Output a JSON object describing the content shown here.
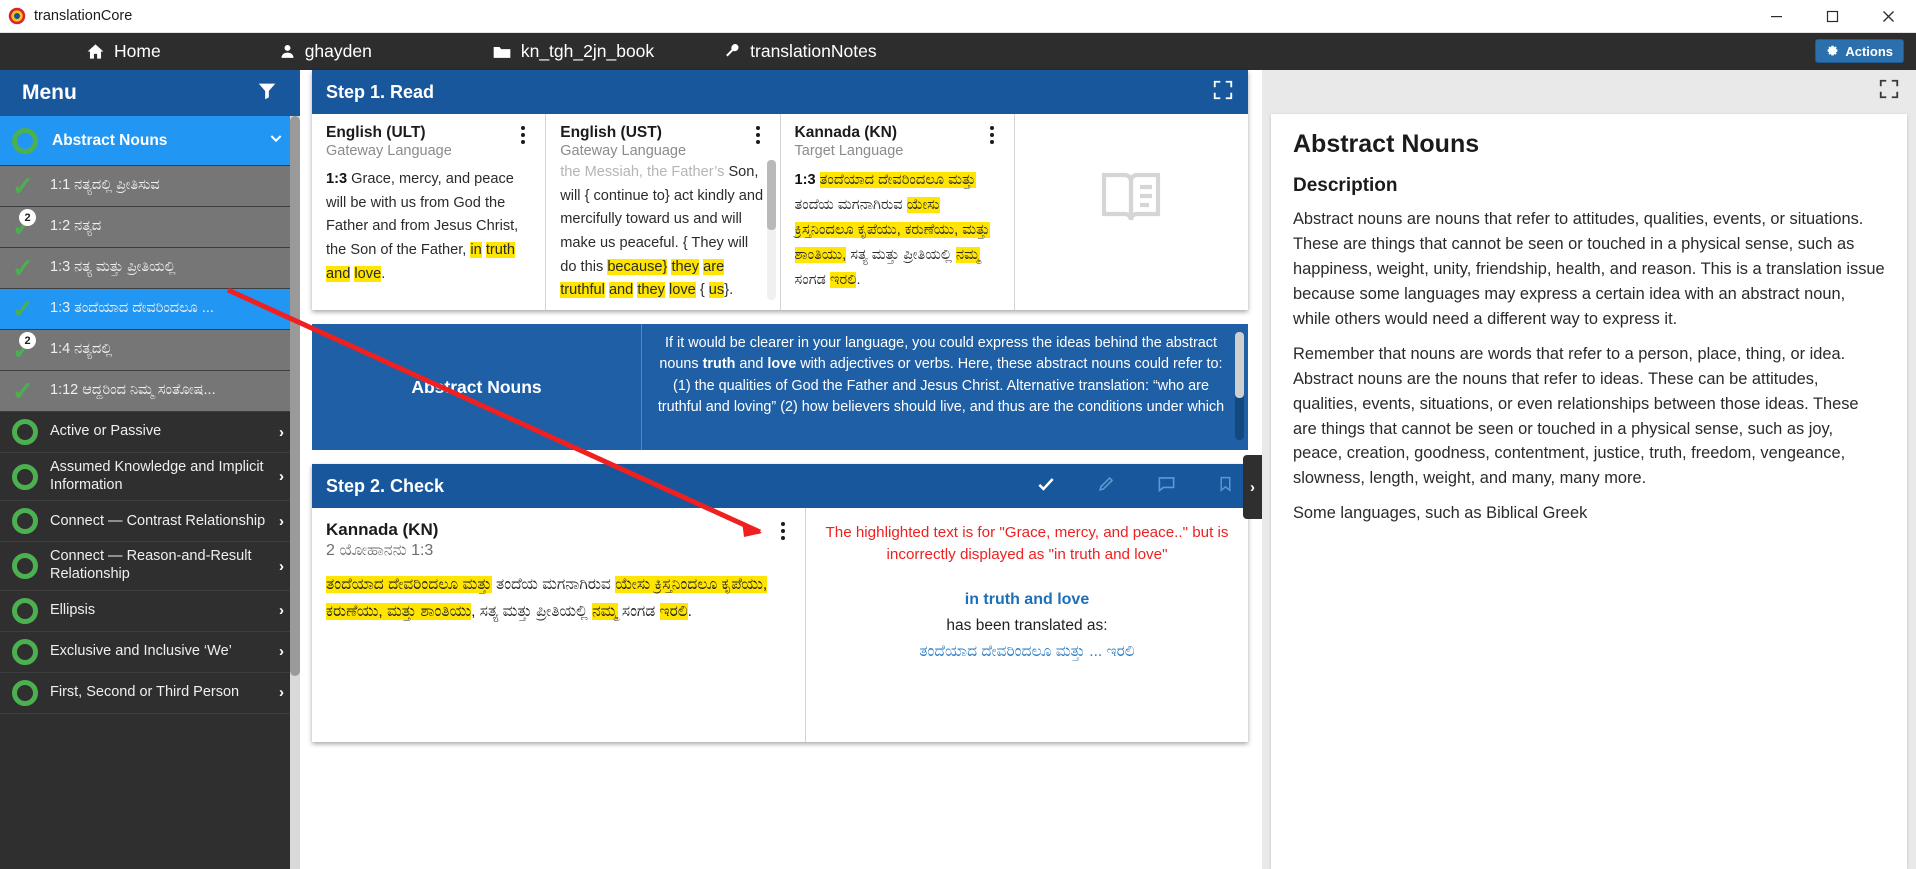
{
  "window": {
    "app_title": "translationCore",
    "controls": {
      "minimize": "minimize-icon",
      "maximize": "maximize-icon",
      "close": "close-icon"
    }
  },
  "nav": {
    "items": [
      {
        "label": "Home",
        "icon": "home-icon"
      },
      {
        "label": "ghayden",
        "icon": "user-icon"
      },
      {
        "label": "kn_tgh_2jn_book",
        "icon": "folder-icon"
      },
      {
        "label": "translationNotes",
        "icon": "wrench-icon"
      }
    ],
    "actions_label": "Actions",
    "actions_icon": "gear-icon"
  },
  "sidebar": {
    "header": {
      "title": "Menu",
      "filter_icon": "filter-icon"
    },
    "group": {
      "label": "Abstract Nouns",
      "chevron": "chevron-down-icon",
      "state_icon": "ring-icon"
    },
    "items": [
      {
        "label": "1:1 ನತ್ಯದಲ್ಲಿ ಪ್ರೀತಿಸುವ",
        "status": "done",
        "badge": "",
        "state": "done"
      },
      {
        "label": "1:2 ನತ್ಯದ",
        "status": "done",
        "badge": "2",
        "state": "done"
      },
      {
        "label": "1:3 ನತ್ಯ ಮತ್ತು ಪ್ರೀತಿಯಲ್ಲಿ",
        "status": "done",
        "badge": "",
        "state": "done"
      },
      {
        "label": "1:3 ತಂದೆಯಾದ ದೇವರಿಂದಲೂ ...",
        "status": "done",
        "badge": "",
        "state": "selected"
      },
      {
        "label": "1:4 ನತ್ಯದಲ್ಲಿ",
        "status": "done",
        "badge": "2",
        "state": "done"
      },
      {
        "label": "1:12 ಆದ್ದರಿಂದ ನಿಮ್ಮ ಸಂತೋಷ...",
        "status": "done",
        "badge": "",
        "state": "done"
      }
    ],
    "categories": [
      {
        "label": "Active or Passive",
        "chevron": "chevron-right-icon"
      },
      {
        "label": "Assumed Knowledge and Implicit Information",
        "chevron": "chevron-right-icon"
      },
      {
        "label": "Connect — Contrast Relationship",
        "chevron": "chevron-right-icon"
      },
      {
        "label": "Connect — Reason-and-Result Relationship",
        "chevron": "chevron-right-icon"
      },
      {
        "label": "Ellipsis",
        "chevron": "chevron-right-icon"
      },
      {
        "label": "Exclusive and Inclusive ‘We’",
        "chevron": "chevron-right-icon"
      },
      {
        "label": "First, Second or Third Person",
        "chevron": "chevron-right-icon"
      }
    ]
  },
  "step1": {
    "title": "Step 1. Read",
    "expand_icon": "expand-icon",
    "panes": [
      {
        "title": "English (ULT)",
        "subtitle": "Gateway Language",
        "verse_ref": "1:3",
        "menu_icon": "kebab-menu-icon",
        "text_pre": " Grace, mercy, and peace will be with us from God the Father and from Jesus Christ, the Son of the Father, ",
        "highlights": [
          "in",
          "truth",
          "and",
          "love"
        ],
        "text_post": "."
      },
      {
        "title": "English (UST)",
        "subtitle": "Gateway Language",
        "menu_icon": "kebab-menu-icon",
        "clipped_line": "the Messiah, the Father’s",
        "text_lines": "Son, will { continue to} act kindly and mercifully toward us and will make us peaceful. { They will do this ",
        "hl1": "because}",
        "mid1": " ",
        "hl2": "they",
        "mid2": " ",
        "hl3": "are",
        "mid3": " ",
        "hl4": "truthful",
        "mid4": " ",
        "hl5": "and",
        "mid5": " ",
        "hl6": "they",
        "mid6": " ",
        "hl7": "love",
        "mid7": " { ",
        "hl8": "us",
        "text_end": "}."
      },
      {
        "title": "Kannada (KN)",
        "subtitle": "Target Language",
        "verse_ref": "1:3",
        "menu_icon": "kebab-menu-icon",
        "k1": "ತಂದೆಯಾದ ದೇವರಿಂದಲೂ ಮತ್ತು",
        "k2": " ತಂದೆಯ ಮಗನಾಗಿರುವ ",
        "k3": "ಯೇಸು ಕ್ರಿಸ್ತನಿಂದಲೂ ಕೃಪೆಯು, ಕರುಣೆಯು, ಮತ್ತು ಶಾಂತಿಯು,",
        "k4": " ಸತ್ಯ ಮತ್ತು ಪ್ರೀತಿಯಲ್ಲಿ ",
        "k5": "ನಮ್ಮ",
        "k6": " ಸಂಗಡ ",
        "k7": "ಇರಲಿ",
        "k8": "."
      },
      {
        "icon": "book-icon"
      }
    ]
  },
  "note_panel": {
    "left_title": "Abstract Nouns",
    "text_a": "If it would be clearer in your language, you could express the ideas behind the abstract nouns ",
    "bold_1": "truth",
    "text_b": " and ",
    "bold_2": "love",
    "text_c": " with adjectives or verbs. Here, these abstract nouns could refer to: (1) the qualities of God the Father and Jesus Christ. Alternative translation: “who are truthful and loving” (2) how believers should live, and thus are the conditions under which"
  },
  "step2": {
    "title": "Step 2. Check",
    "icons": [
      "check-icon",
      "pencil-icon",
      "comment-icon",
      "bookmark-icon"
    ],
    "left": {
      "title": "Kannada (KN)",
      "reference": "2 ಯೋಹಾನನು 1:3",
      "menu_icon": "kebab-menu-icon",
      "k1": "ತಂದೆಯಾದ ದೇವರಿಂದಲೂ ಮತ್ತು",
      "k2": " ತಂದೆಯ ಮಗನಾಗಿರುವ ",
      "k3": "ಯೇಸು ಕ್ರಿಸ್ತನಿಂದಲೂ ಕೃಪೆಯು, ಕರುಣೆಯು, ಮತ್ತು ಶಾಂತಿಯು",
      "k4": ", ಸತ್ಯ ಮತ್ತು ಪ್ರೀತಿಯಲ್ಲಿ ",
      "k5": "ನಮ್ಮ",
      "k6": " ಸಂಗಡ ",
      "k7": "ಇರಲಿ",
      "k8": "."
    },
    "right": {
      "red_note_line1": "The highlighted text is for \"Grace, mercy, and peace..\" but is",
      "red_note_line2": "incorrectly displayed as \"in truth and love\"",
      "phrase": "in truth and love",
      "translated_as_label": "has been translated as:",
      "translation": "ತಂದೆಯಾದ ದೇವರಿಂದಲೂ ಮತ್ತು ... ಇರಲಿ"
    }
  },
  "rightpanel": {
    "expand_icon": "expand-icon",
    "drawer_handle_icon": "chevron-right-icon",
    "title": "Abstract Nouns",
    "heading": "Description",
    "paragraphs": [
      "Abstract nouns are nouns that refer to attitudes, qualities, events, or situations. These are things that cannot be seen or touched in a physical sense, such as happiness, weight, unity, friendship, health, and reason. This is a translation issue because some languages may express a certain idea with an abstract noun, while others would need a different way to express it.",
      "Remember that nouns are words that refer to a person, place, thing, or idea. Abstract nouns are the nouns that refer to ideas. These can be attitudes, qualities, events, situations, or even relationships between those ideas. These are things that cannot be seen or touched in a physical sense, such as joy, peace, creation, goodness, contentment, justice, truth, freedom, vengeance, slowness, length, weight, and many, many more.",
      "Some languages, such as Biblical Greek"
    ]
  },
  "colors": {
    "accent_blue": "#18579c",
    "nav_dark": "#2d2d2d",
    "highlight_yellow": "#ffe500",
    "green": "#4caf50",
    "selected_blue": "#2196f3",
    "annotation_red": "#f02020",
    "link_blue": "#1d6fb8"
  }
}
